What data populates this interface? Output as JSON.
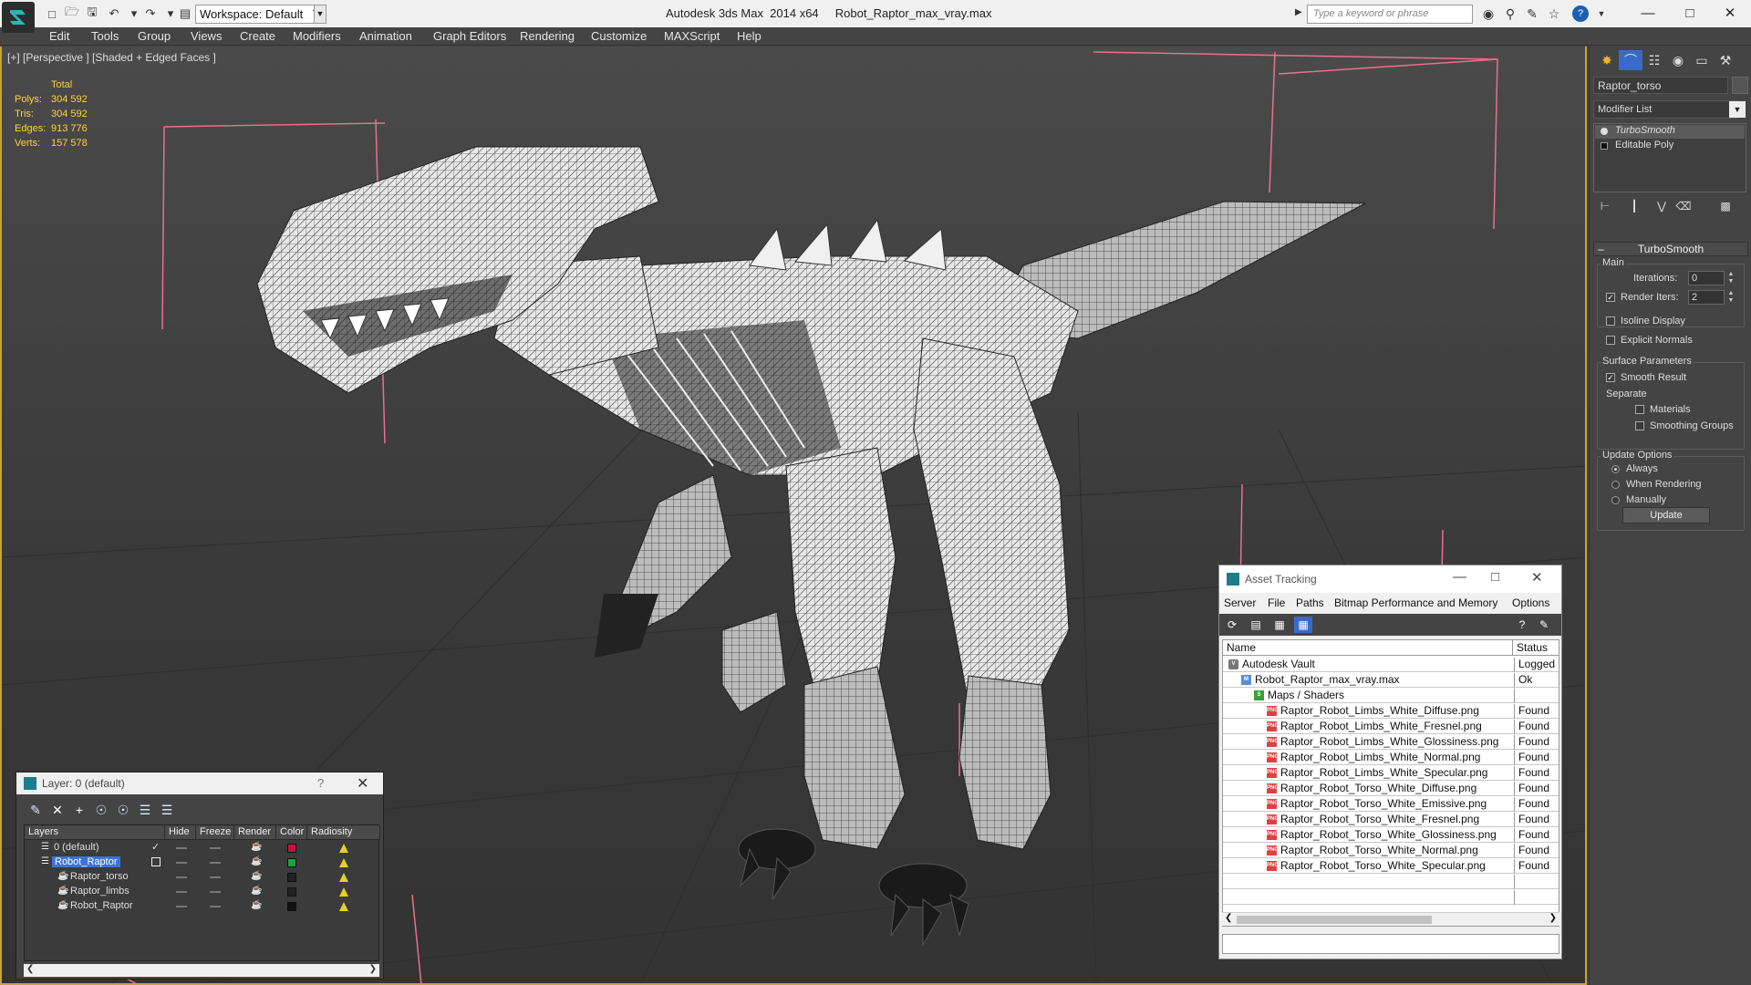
{
  "titlebar": {
    "workspace": "Workspace: Default",
    "app_name": "Autodesk 3ds Max  2014 x64",
    "file_name": "Robot_Raptor_max_vray.max",
    "search_placeholder": "Type a keyword or phrase"
  },
  "menu": [
    "Edit",
    "Tools",
    "Group",
    "Views",
    "Create",
    "Modifiers",
    "Animation",
    "Graph Editors",
    "Rendering",
    "Customize",
    "MAXScript",
    "Help"
  ],
  "viewport": {
    "label": "[+] [Perspective ] [Shaded + Edged Faces ]",
    "stats": {
      "header": "Total",
      "rows": [
        {
          "label": "Polys:",
          "value": "304 592"
        },
        {
          "label": "Tris:",
          "value": "304 592"
        },
        {
          "label": "Edges:",
          "value": "913 776"
        },
        {
          "label": "Verts:",
          "value": "157 578"
        }
      ]
    }
  },
  "command_panel": {
    "object_name": "Raptor_torso",
    "modifier_list": "Modifier List",
    "stack": [
      "TurboSmooth",
      "Editable Poly"
    ],
    "rollout_title": "TurboSmooth",
    "main_group": "Main",
    "iterations_label": "Iterations:",
    "iterations_value": "0",
    "render_iters_label": "Render Iters:",
    "render_iters_value": "2",
    "render_iters_checked": true,
    "isoline_label": "Isoline Display",
    "explicit_normals_label": "Explicit Normals",
    "surface_group": "Surface Parameters",
    "smooth_result_label": "Smooth Result",
    "separate_label": "Separate",
    "materials_label": "Materials",
    "smoothing_groups_label": "Smoothing Groups",
    "update_group": "Update Options",
    "always_label": "Always",
    "when_rendering_label": "When Rendering",
    "manually_label": "Manually",
    "update_button": "Update"
  },
  "layer_dialog": {
    "title": "Layer: 0 (default)",
    "help": "?",
    "columns": [
      "Layers",
      "Hide",
      "Freeze",
      "Render",
      "Color",
      "Radiosity"
    ],
    "rows": [
      {
        "name": "0 (default)",
        "color": "#c0143c",
        "selected": false,
        "checked": true
      },
      {
        "name": "Robot_Raptor",
        "color": "#1ea040",
        "selected": true,
        "checked": false
      },
      {
        "name": "Raptor_torso",
        "color": "#222222",
        "selected": false,
        "checked": false
      },
      {
        "name": "Raptor_limbs",
        "color": "#222222",
        "selected": false,
        "checked": false
      },
      {
        "name": "Robot_Raptor",
        "color": "#111111",
        "selected": false,
        "checked": false
      }
    ]
  },
  "asset_tracking": {
    "title": "Asset Tracking",
    "menu": [
      "Server",
      "File",
      "Paths",
      "Bitmap Performance and Memory",
      "Options"
    ],
    "columns": [
      "Name",
      "Status"
    ],
    "rows": [
      {
        "name": "Autodesk Vault",
        "status": "Logged Out",
        "icon": "vault",
        "indent": 0
      },
      {
        "name": "Robot_Raptor_max_vray.max",
        "status": "Ok",
        "icon": "file",
        "indent": 1
      },
      {
        "name": "Maps / Shaders",
        "status": "",
        "icon": "maps",
        "indent": 2
      },
      {
        "name": "Raptor_Robot_Limbs_White_Diffuse.png",
        "status": "Found",
        "icon": "png",
        "indent": 3
      },
      {
        "name": "Raptor_Robot_Limbs_White_Fresnel.png",
        "status": "Found",
        "icon": "png",
        "indent": 3
      },
      {
        "name": "Raptor_Robot_Limbs_White_Glossiness.png",
        "status": "Found",
        "icon": "png",
        "indent": 3
      },
      {
        "name": "Raptor_Robot_Limbs_White_Normal.png",
        "status": "Found",
        "icon": "png",
        "indent": 3
      },
      {
        "name": "Raptor_Robot_Limbs_White_Specular.png",
        "status": "Found",
        "icon": "png",
        "indent": 3
      },
      {
        "name": "Raptor_Robot_Torso_White_Diffuse.png",
        "status": "Found",
        "icon": "png",
        "indent": 3
      },
      {
        "name": "Raptor_Robot_Torso_White_Emissive.png",
        "status": "Found",
        "icon": "png",
        "indent": 3
      },
      {
        "name": "Raptor_Robot_Torso_White_Fresnel.png",
        "status": "Found",
        "icon": "png",
        "indent": 3
      },
      {
        "name": "Raptor_Robot_Torso_White_Glossiness.png",
        "status": "Found",
        "icon": "png",
        "indent": 3
      },
      {
        "name": "Raptor_Robot_Torso_White_Normal.png",
        "status": "Found",
        "icon": "png",
        "indent": 3
      },
      {
        "name": "Raptor_Robot_Torso_White_Specular.png",
        "status": "Found",
        "icon": "png",
        "indent": 3
      }
    ]
  },
  "colors": {
    "viewport_border": "#c8a430",
    "stats_text": "#ffd23f",
    "selection_blue": "#3c74d8"
  }
}
